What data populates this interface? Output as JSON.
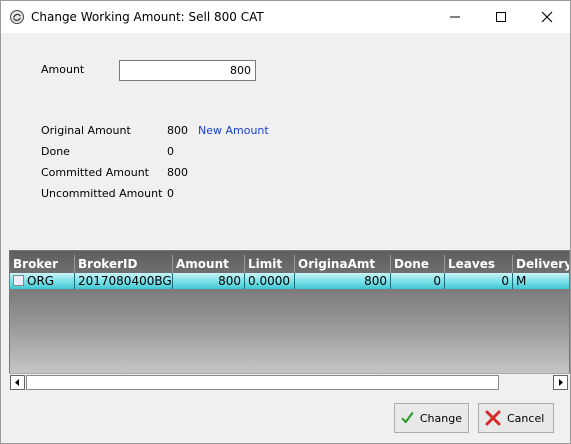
{
  "window": {
    "title": "Change Working Amount: Sell 800 CAT"
  },
  "form": {
    "amount_label": "Amount",
    "amount_value": "800",
    "original_amount_label": "Original Amount",
    "original_amount_value": "800",
    "new_amount_link": "New Amount",
    "done_label": "Done",
    "done_value": "0",
    "committed_label": "Committed Amount",
    "committed_value": "800",
    "uncommitted_label": "Uncommitted Amount",
    "uncommitted_value": "0"
  },
  "grid": {
    "columns": [
      "Broker",
      "BrokerID",
      "Amount",
      "Limit",
      "OriginaAmt",
      "Done",
      "Leaves",
      "Delivery"
    ],
    "row": {
      "broker": "ORG",
      "broker_id": "2017080400BG",
      "amount": "800",
      "limit": "0.0000",
      "original_amt": "800",
      "done": "0",
      "leaves": "0",
      "delivery": "M"
    }
  },
  "buttons": {
    "change": "Change",
    "cancel": "Cancel"
  },
  "icons": {
    "app": "app-icon",
    "minimize": "minimize-icon",
    "maximize": "maximize-icon",
    "close": "close-icon",
    "check": "check-icon",
    "cancel": "cancel-x-icon"
  },
  "colors": {
    "link": "#1a3fd1",
    "row_highlight": "#7fe2ea",
    "check_green": "#2e9a2e",
    "cancel_red": "#d42a2a"
  }
}
